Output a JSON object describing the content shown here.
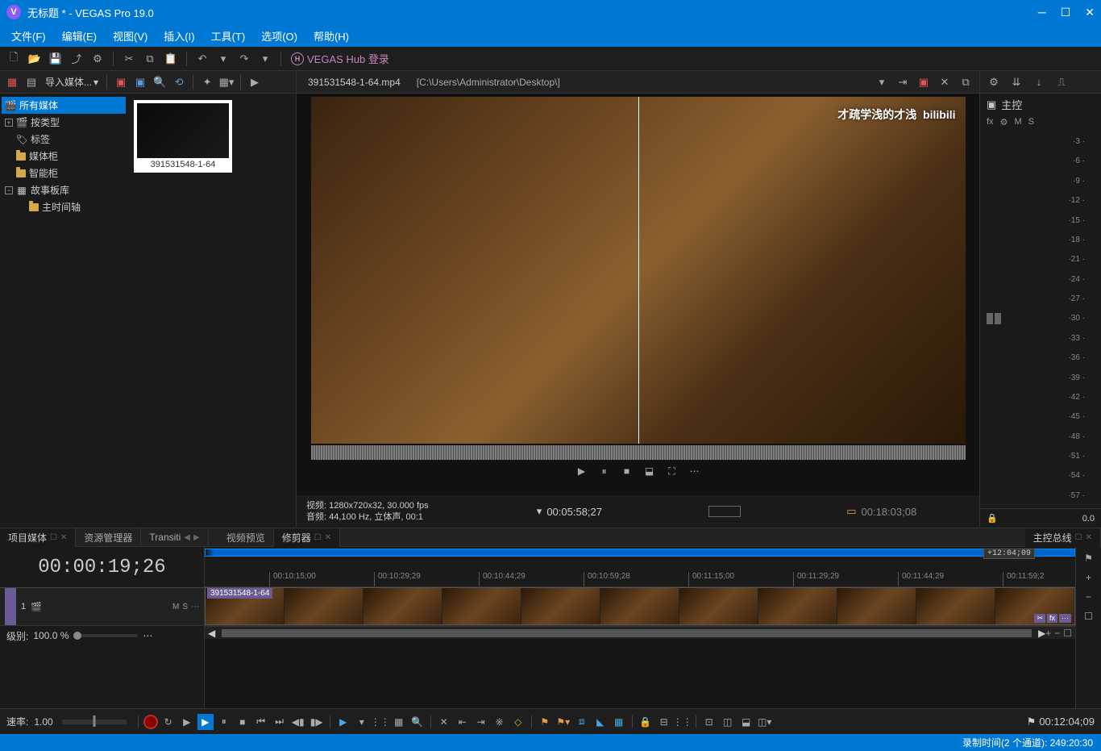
{
  "titlebar": {
    "logo_letter": "V",
    "title": "无标题 * - VEGAS Pro 19.0"
  },
  "menu": {
    "file": "文件(F)",
    "edit": "编辑(E)",
    "view": "视图(V)",
    "insert": "插入(I)",
    "tools": "工具(T)",
    "options": "选项(O)",
    "help": "帮助(H)"
  },
  "hub": {
    "login_label": "VEGAS Hub 登录"
  },
  "media_panel": {
    "import_label": "导入媒体...",
    "tree": {
      "all_media": "所有媒体",
      "by_type": "按类型",
      "tags": "标签",
      "media_bin": "媒体柜",
      "smart_bin": "智能柜",
      "storyboard": "故事板库",
      "main_timeline": "主时间轴"
    },
    "clip_caption": "391531548-1-64"
  },
  "preview": {
    "file": "391531548-1-64.mp4",
    "path": "[C:\\Users\\Administrator\\Desktop\\]",
    "watermark": "才疏学浅的才浅",
    "bilibili": "bilibili",
    "video_info": "视频: 1280x720x32, 30.000 fps",
    "audio_info": "音频: 44,100 Hz, 立体声, 00:1",
    "tc_current": "00:05:58;27",
    "tc_total": "00:18:03;08"
  },
  "master": {
    "title": "主控",
    "fx": "fx",
    "m": "M",
    "s": "S",
    "readout": "0.0"
  },
  "meter_ticks": [
    "3",
    "6",
    "9",
    "12",
    "15",
    "18",
    "21",
    "24",
    "27",
    "30",
    "33",
    "36",
    "39",
    "42",
    "45",
    "48",
    "51",
    "54",
    "57"
  ],
  "tabs_left": {
    "project_media": "项目媒体",
    "explorer": "资源管理器",
    "transitions": "Transiti"
  },
  "tabs_center": {
    "video_preview": "视频预览",
    "trimmer": "修剪器"
  },
  "tabs_right": {
    "master_bus": "主控总线"
  },
  "timeline": {
    "cursor_tc": "00:00:19;26",
    "end_marker": "+12:04;09",
    "ruler": [
      "00:10:15;00",
      "00:10:29;29",
      "00:10:44;29",
      "00:10:59;28",
      "00:11:15;00",
      "00:11:29;29",
      "00:11:44;29",
      "00:11:59;2"
    ],
    "track": {
      "num": "1",
      "m": "M",
      "s": "S",
      "level_label": "级别:",
      "level_value": "100.0 %"
    },
    "clip_name": "391531548-1-64",
    "fx_label": "fx"
  },
  "bottom": {
    "rate_label": "速率:",
    "rate_value": "1.00",
    "tc": "00:12:04;09"
  },
  "status": {
    "text": "录制时间(2 个通道): 249:20:30"
  }
}
